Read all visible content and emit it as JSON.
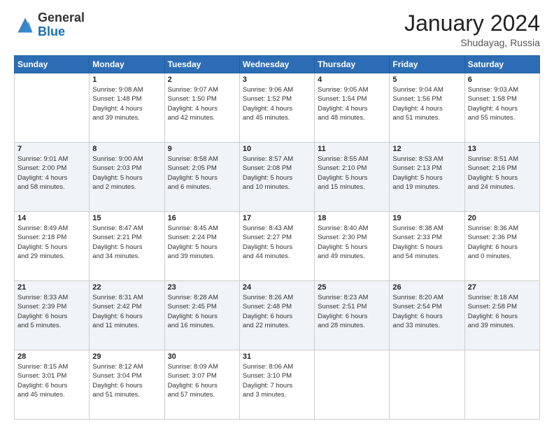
{
  "logo": {
    "general": "General",
    "blue": "Blue"
  },
  "title": "January 2024",
  "location": "Shudayag, Russia",
  "days_header": [
    "Sunday",
    "Monday",
    "Tuesday",
    "Wednesday",
    "Thursday",
    "Friday",
    "Saturday"
  ],
  "weeks": [
    [
      {
        "day": "",
        "info": ""
      },
      {
        "day": "1",
        "info": "Sunrise: 9:08 AM\nSunset: 1:48 PM\nDaylight: 4 hours\nand 39 minutes."
      },
      {
        "day": "2",
        "info": "Sunrise: 9:07 AM\nSunset: 1:50 PM\nDaylight: 4 hours\nand 42 minutes."
      },
      {
        "day": "3",
        "info": "Sunrise: 9:06 AM\nSunset: 1:52 PM\nDaylight: 4 hours\nand 45 minutes."
      },
      {
        "day": "4",
        "info": "Sunrise: 9:05 AM\nSunset: 1:54 PM\nDaylight: 4 hours\nand 48 minutes."
      },
      {
        "day": "5",
        "info": "Sunrise: 9:04 AM\nSunset: 1:56 PM\nDaylight: 4 hours\nand 51 minutes."
      },
      {
        "day": "6",
        "info": "Sunrise: 9:03 AM\nSunset: 1:58 PM\nDaylight: 4 hours\nand 55 minutes."
      }
    ],
    [
      {
        "day": "7",
        "info": "Sunrise: 9:01 AM\nSunset: 2:00 PM\nDaylight: 4 hours\nand 58 minutes."
      },
      {
        "day": "8",
        "info": "Sunrise: 9:00 AM\nSunset: 2:03 PM\nDaylight: 5 hours\nand 2 minutes."
      },
      {
        "day": "9",
        "info": "Sunrise: 8:58 AM\nSunset: 2:05 PM\nDaylight: 5 hours\nand 6 minutes."
      },
      {
        "day": "10",
        "info": "Sunrise: 8:57 AM\nSunset: 2:08 PM\nDaylight: 5 hours\nand 10 minutes."
      },
      {
        "day": "11",
        "info": "Sunrise: 8:55 AM\nSunset: 2:10 PM\nDaylight: 5 hours\nand 15 minutes."
      },
      {
        "day": "12",
        "info": "Sunrise: 8:53 AM\nSunset: 2:13 PM\nDaylight: 5 hours\nand 19 minutes."
      },
      {
        "day": "13",
        "info": "Sunrise: 8:51 AM\nSunset: 2:16 PM\nDaylight: 5 hours\nand 24 minutes."
      }
    ],
    [
      {
        "day": "14",
        "info": "Sunrise: 8:49 AM\nSunset: 2:18 PM\nDaylight: 5 hours\nand 29 minutes."
      },
      {
        "day": "15",
        "info": "Sunrise: 8:47 AM\nSunset: 2:21 PM\nDaylight: 5 hours\nand 34 minutes."
      },
      {
        "day": "16",
        "info": "Sunrise: 8:45 AM\nSunset: 2:24 PM\nDaylight: 5 hours\nand 39 minutes."
      },
      {
        "day": "17",
        "info": "Sunrise: 8:43 AM\nSunset: 2:27 PM\nDaylight: 5 hours\nand 44 minutes."
      },
      {
        "day": "18",
        "info": "Sunrise: 8:40 AM\nSunset: 2:30 PM\nDaylight: 5 hours\nand 49 minutes."
      },
      {
        "day": "19",
        "info": "Sunrise: 8:38 AM\nSunset: 2:33 PM\nDaylight: 5 hours\nand 54 minutes."
      },
      {
        "day": "20",
        "info": "Sunrise: 8:36 AM\nSunset: 2:36 PM\nDaylight: 6 hours\nand 0 minutes."
      }
    ],
    [
      {
        "day": "21",
        "info": "Sunrise: 8:33 AM\nSunset: 2:39 PM\nDaylight: 6 hours\nand 5 minutes."
      },
      {
        "day": "22",
        "info": "Sunrise: 8:31 AM\nSunset: 2:42 PM\nDaylight: 6 hours\nand 11 minutes."
      },
      {
        "day": "23",
        "info": "Sunrise: 8:28 AM\nSunset: 2:45 PM\nDaylight: 6 hours\nand 16 minutes."
      },
      {
        "day": "24",
        "info": "Sunrise: 8:26 AM\nSunset: 2:48 PM\nDaylight: 6 hours\nand 22 minutes."
      },
      {
        "day": "25",
        "info": "Sunrise: 8:23 AM\nSunset: 2:51 PM\nDaylight: 6 hours\nand 28 minutes."
      },
      {
        "day": "26",
        "info": "Sunrise: 8:20 AM\nSunset: 2:54 PM\nDaylight: 6 hours\nand 33 minutes."
      },
      {
        "day": "27",
        "info": "Sunrise: 8:18 AM\nSunset: 2:58 PM\nDaylight: 6 hours\nand 39 minutes."
      }
    ],
    [
      {
        "day": "28",
        "info": "Sunrise: 8:15 AM\nSunset: 3:01 PM\nDaylight: 6 hours\nand 45 minutes."
      },
      {
        "day": "29",
        "info": "Sunrise: 8:12 AM\nSunset: 3:04 PM\nDaylight: 6 hours\nand 51 minutes."
      },
      {
        "day": "30",
        "info": "Sunrise: 8:09 AM\nSunset: 3:07 PM\nDaylight: 6 hours\nand 57 minutes."
      },
      {
        "day": "31",
        "info": "Sunrise: 8:06 AM\nSunset: 3:10 PM\nDaylight: 7 hours\nand 3 minutes."
      },
      {
        "day": "",
        "info": ""
      },
      {
        "day": "",
        "info": ""
      },
      {
        "day": "",
        "info": ""
      }
    ]
  ]
}
